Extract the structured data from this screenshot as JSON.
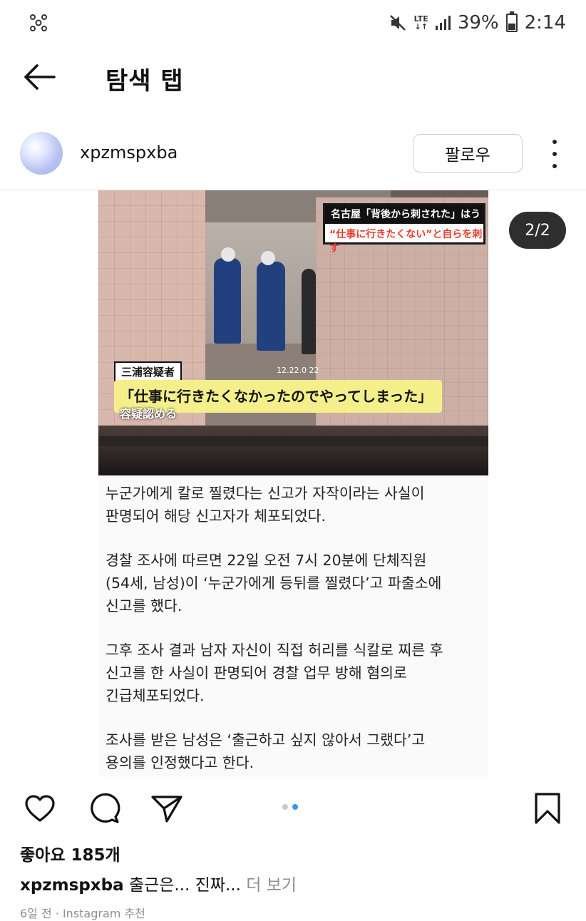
{
  "status_bar": {
    "network": "LTE",
    "battery_text": "39%",
    "time": "2:14",
    "battery_level": 0.39,
    "icons": [
      "app-notification-icon",
      "mute-icon",
      "lte-icon",
      "signal-icon",
      "battery-icon"
    ]
  },
  "app_bar": {
    "title": "탐색 탭",
    "back_icon": "back-arrow-icon"
  },
  "post": {
    "username": "xpzmspxba",
    "follow_label": "팔로우",
    "more_icon": "more-vertical-icon",
    "page_counter": "2/2",
    "media": {
      "photo_caption_band": "名古屋「背後から刺された」はうそ",
      "photo_caption_line2": "“仕事に行きたくない”と自らを刺す",
      "photo_tag": "三浦容疑者",
      "photo_quote": "「仕事に行きたくなかったのでやってしまった」",
      "photo_sub": "容疑認める",
      "photo_timestamp": "12.22.0 22",
      "article_lines": [
        "누군가에게 칼로 찔렸다는 신고가 자작이라는 사실이",
        "판명되어 해당 신고자가 체포되었다.",
        "경찰 조사에 따르면 22일 오전 7시 20분에 단체직원",
        "(54세, 남성)이 ‘누군가에게 등뒤를 찔렸다’고 파출소에",
        "신고를 했다.",
        "그후 조사 결과 남자 자신이 직접 허리를 식칼로 찌른 후",
        "신고를 한 사실이 판명되어 경찰 업무 방해 혐의로",
        "긴급체포되었다.",
        "조사를 받은 남성은 ‘출근하고 싶지 않아서 그랬다’고",
        "용의를 인정했다고 한다."
      ]
    },
    "actions": {
      "like_icon": "heart-icon",
      "comment_icon": "comment-icon",
      "share_icon": "send-icon",
      "save_icon": "bookmark-icon"
    },
    "carousel": {
      "count": 2,
      "active_index": 1
    },
    "likes_text": "좋아요 185개",
    "caption": {
      "username": "xpzmspxba",
      "text": "출근은... 진짜...",
      "more": "더 보기"
    },
    "timestamp": "6일 전 · Instagram 추천"
  },
  "colors": {
    "accent": "#3797f0",
    "counter_bg": "#2e2e2e",
    "muted": "#8e8e8e"
  }
}
